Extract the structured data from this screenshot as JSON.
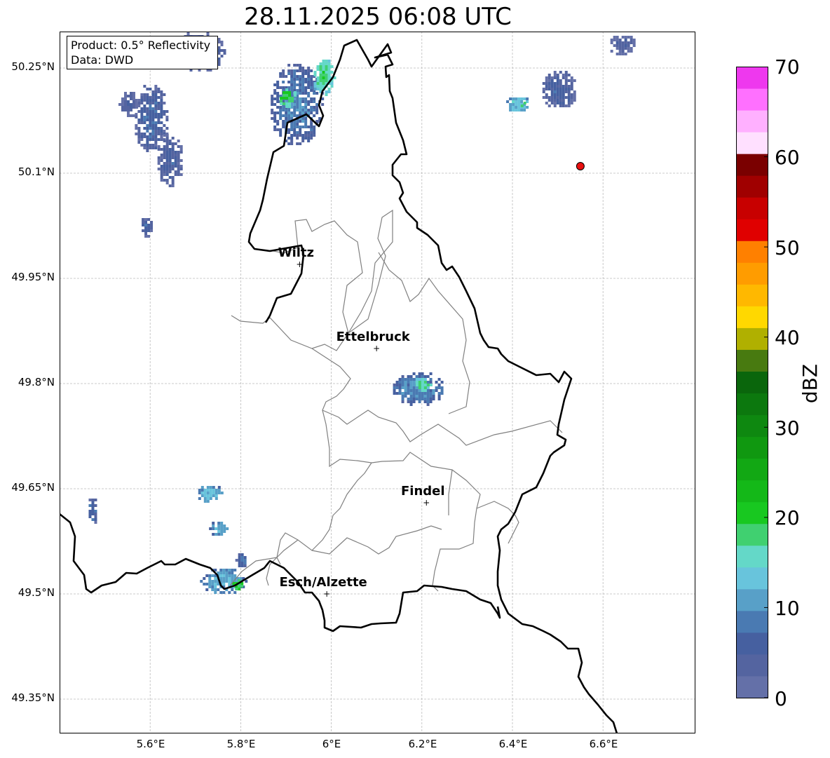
{
  "title": "28.11.2025 06:08 UTC",
  "info": {
    "product": "Product: 0.5° Reflectivity",
    "data": "Data: DWD"
  },
  "axes": {
    "lat_labels": [
      "50.25°N",
      "50.1°N",
      "49.95°N",
      "49.8°N",
      "49.65°N",
      "49.5°N",
      "49.35°N"
    ],
    "lon_labels": [
      "5.6°E",
      "5.8°E",
      "6°E",
      "6.2°E",
      "6.4°E",
      "6.6°E"
    ]
  },
  "cities": [
    {
      "name": "Wiltz",
      "lon": 5.93,
      "lat": 49.97
    },
    {
      "name": "Ettelbruck",
      "lon": 6.1,
      "lat": 49.85
    },
    {
      "name": "Findel",
      "lon": 6.21,
      "lat": 49.63
    },
    {
      "name": "Esch/Alzette",
      "lon": 5.99,
      "lat": 49.5
    }
  ],
  "radar_site": {
    "lon": 6.55,
    "lat": 50.11,
    "color": "#e81010"
  },
  "colorbar": {
    "label": "dBZ",
    "min": 0,
    "max": 70,
    "tick_labels": [
      "0",
      "10",
      "20",
      "30",
      "40",
      "50",
      "60",
      "70"
    ],
    "colors": [
      "#6470a8",
      "#5464a0",
      "#4660a0",
      "#4a7ab2",
      "#58a0c8",
      "#68c4dc",
      "#64d8c8",
      "#40d070",
      "#18c820",
      "#14b818",
      "#12a814",
      "#109810",
      "#0e8810",
      "#0c780e",
      "#0a660c",
      "#487a10",
      "#b0b000",
      "#ffd800",
      "#ffb800",
      "#ff9c00",
      "#ff8000",
      "#e00000",
      "#c80000",
      "#a00000",
      "#7a0000",
      "#ffe0ff",
      "#ffb0ff",
      "#ff70ff",
      "#ee38ee"
    ]
  },
  "echoes": [
    {
      "lon": 5.71,
      "lat": 50.275,
      "rlon": 0.06,
      "rlat": 0.03,
      "dbz": 6
    },
    {
      "lon": 5.92,
      "lat": 50.2,
      "rlon": 0.06,
      "rlat": 0.06,
      "dbz": 9
    },
    {
      "lon": 5.9,
      "lat": 50.21,
      "rlon": 0.02,
      "rlat": 0.015,
      "dbz": 20
    },
    {
      "lon": 5.98,
      "lat": 50.24,
      "rlon": 0.025,
      "rlat": 0.03,
      "dbz": 18
    },
    {
      "lon": 5.6,
      "lat": 50.18,
      "rlon": 0.04,
      "rlat": 0.05,
      "dbz": 7
    },
    {
      "lon": 5.64,
      "lat": 50.12,
      "rlon": 0.03,
      "rlat": 0.04,
      "dbz": 6
    },
    {
      "lon": 5.55,
      "lat": 50.2,
      "rlon": 0.02,
      "rlat": 0.02,
      "dbz": 5
    },
    {
      "lon": 5.59,
      "lat": 50.025,
      "rlon": 0.015,
      "rlat": 0.015,
      "dbz": 6
    },
    {
      "lon": 6.41,
      "lat": 50.2,
      "rlon": 0.03,
      "rlat": 0.012,
      "dbz": 14
    },
    {
      "lon": 6.42,
      "lat": 50.2,
      "rlon": 0.008,
      "rlat": 0.006,
      "dbz": 20
    },
    {
      "lon": 6.5,
      "lat": 50.22,
      "rlon": 0.04,
      "rlat": 0.03,
      "dbz": 6
    },
    {
      "lon": 6.64,
      "lat": 50.285,
      "rlon": 0.03,
      "rlat": 0.015,
      "dbz": 5
    },
    {
      "lon": 6.19,
      "lat": 49.795,
      "rlon": 0.06,
      "rlat": 0.025,
      "dbz": 10
    },
    {
      "lon": 6.2,
      "lat": 49.8,
      "rlon": 0.02,
      "rlat": 0.012,
      "dbz": 18
    },
    {
      "lon": 5.73,
      "lat": 49.645,
      "rlon": 0.03,
      "rlat": 0.013,
      "dbz": 13
    },
    {
      "lon": 5.47,
      "lat": 49.62,
      "rlon": 0.012,
      "rlat": 0.02,
      "dbz": 8
    },
    {
      "lon": 5.75,
      "lat": 49.595,
      "rlon": 0.02,
      "rlat": 0.012,
      "dbz": 12
    },
    {
      "lon": 5.76,
      "lat": 49.52,
      "rlon": 0.05,
      "rlat": 0.02,
      "dbz": 12
    },
    {
      "lon": 5.79,
      "lat": 49.515,
      "rlon": 0.015,
      "rlat": 0.01,
      "dbz": 20
    },
    {
      "lon": 5.8,
      "lat": 49.55,
      "rlon": 0.012,
      "rlat": 0.012,
      "dbz": 8
    }
  ]
}
